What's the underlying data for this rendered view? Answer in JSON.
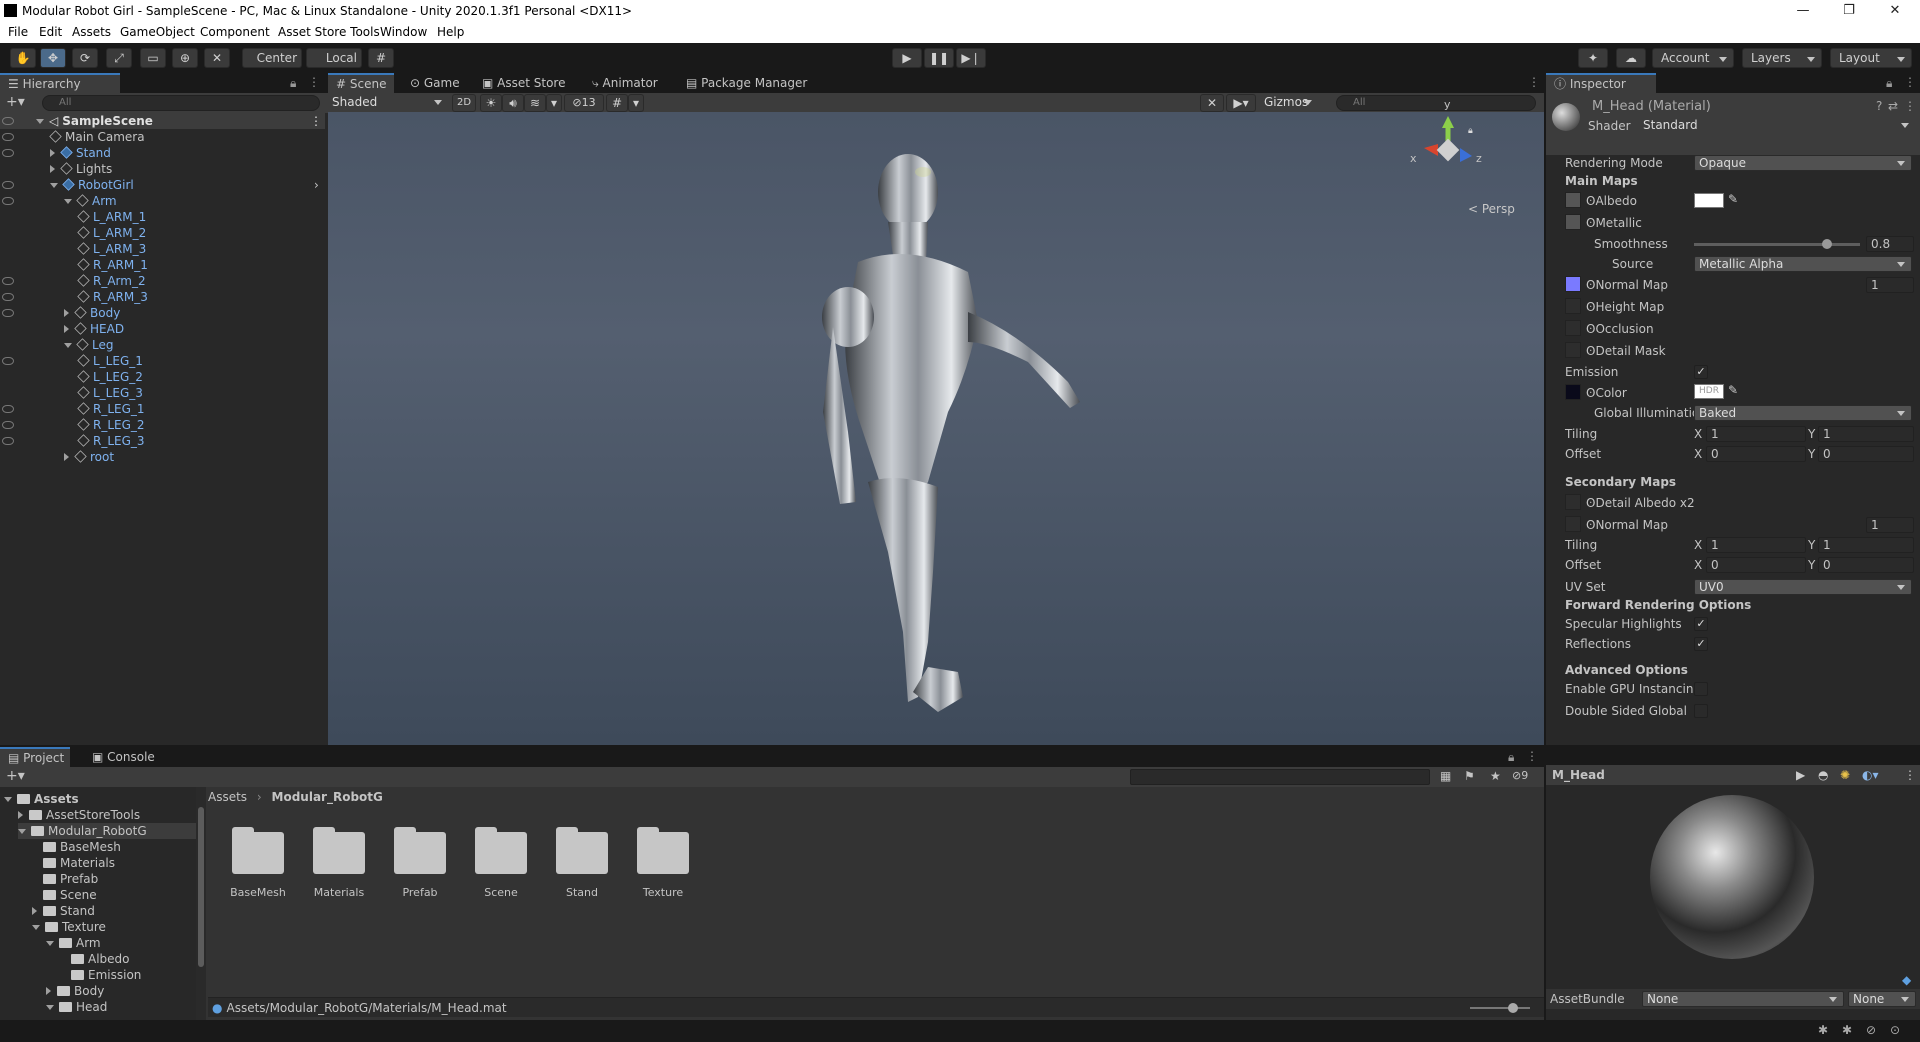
{
  "window": {
    "title": "Modular Robot Girl - SampleScene - PC, Mac & Linux Standalone - Unity 2020.1.3f1 Personal <DX11>",
    "minimize": "—",
    "maximize": "❐",
    "close": "✕"
  },
  "menu": [
    "File",
    "Edit",
    "Assets",
    "GameObject",
    "Component",
    "Asset Store Tools",
    "Window",
    "Help"
  ],
  "toolbar": {
    "pivot": "Center",
    "space": "Local",
    "account": "Account",
    "layers": "Layers",
    "layout": "Layout"
  },
  "hierarchy": {
    "tab": "Hierarchy",
    "search_placeholder": "All",
    "scene": "SampleScene",
    "items": [
      {
        "label": "Main Camera",
        "depth": 1,
        "arrow": "",
        "blue": false
      },
      {
        "label": "Stand",
        "depth": 1,
        "arrow": "r",
        "blue": true
      },
      {
        "label": "Lights",
        "depth": 1,
        "arrow": "r",
        "blue": false
      },
      {
        "label": "RobotGirl",
        "depth": 1,
        "arrow": "d",
        "blue": true
      },
      {
        "label": "Arm",
        "depth": 2,
        "arrow": "d",
        "blue": true
      },
      {
        "label": "L_ARM_1",
        "depth": 3,
        "arrow": "",
        "blue": true
      },
      {
        "label": "L_ARM_2",
        "depth": 3,
        "arrow": "",
        "blue": true
      },
      {
        "label": "L_ARM_3",
        "depth": 3,
        "arrow": "",
        "blue": true
      },
      {
        "label": "R_ARM_1",
        "depth": 3,
        "arrow": "",
        "blue": true
      },
      {
        "label": "R_Arm_2",
        "depth": 3,
        "arrow": "",
        "blue": true
      },
      {
        "label": "R_ARM_3",
        "depth": 3,
        "arrow": "",
        "blue": true
      },
      {
        "label": "Body",
        "depth": 2,
        "arrow": "r",
        "blue": true
      },
      {
        "label": "HEAD",
        "depth": 2,
        "arrow": "r",
        "blue": true
      },
      {
        "label": "Leg",
        "depth": 2,
        "arrow": "d",
        "blue": true
      },
      {
        "label": "L_LEG_1",
        "depth": 3,
        "arrow": "",
        "blue": true
      },
      {
        "label": "L_LEG_2",
        "depth": 3,
        "arrow": "",
        "blue": true
      },
      {
        "label": "L_LEG_3",
        "depth": 3,
        "arrow": "",
        "blue": true
      },
      {
        "label": "R_LEG_1",
        "depth": 3,
        "arrow": "",
        "blue": true
      },
      {
        "label": "R_LEG_2",
        "depth": 3,
        "arrow": "",
        "blue": true
      },
      {
        "label": "R_LEG_3",
        "depth": 3,
        "arrow": "",
        "blue": true
      },
      {
        "label": "root",
        "depth": 2,
        "arrow": "r",
        "blue": true
      }
    ]
  },
  "scene_tabs": [
    "Scene",
    "Game",
    "Asset Store",
    "Animator",
    "Package Manager"
  ],
  "scene_toolbar": {
    "shading": "Shaded",
    "mode2d": "2D",
    "hidden_count": "13",
    "gizmos": "Gizmos",
    "search_placeholder": "All"
  },
  "gizmo": {
    "y": "y",
    "x": "x",
    "z": "z",
    "persp": "< Persp"
  },
  "inspector": {
    "tab": "Inspector",
    "material": "M_Head (Material)",
    "shader_label": "Shader",
    "shader": "Standard",
    "rendering_mode_label": "Rendering Mode",
    "rendering_mode": "Opaque",
    "main_maps": "Main Maps",
    "albedo": "Albedo",
    "metallic": "Metallic",
    "smoothness_label": "Smoothness",
    "smoothness": "0.8",
    "smoothness_fraction": 0.8,
    "source_label": "Source",
    "source": "Metallic Alpha",
    "normal_map": "Normal Map",
    "normal_value": "1",
    "height_map": "Height Map",
    "occlusion": "Occlusion",
    "detail_mask": "Detail Mask",
    "emission": "Emission",
    "emission_checked": "✓",
    "color": "Color",
    "hdr": "HDR",
    "gi_label": "Global Illuminatio",
    "gi": "Baked",
    "tiling": "Tiling",
    "offset": "Offset",
    "x": "X",
    "y": "Y",
    "tiling_x": "1",
    "tiling_y": "1",
    "offset_x": "0",
    "offset_y": "0",
    "secondary_maps": "Secondary Maps",
    "detail_albedo": "Detail Albedo x2",
    "normal_map2": "Normal Map",
    "normal_value2": "1",
    "tiling2_x": "1",
    "tiling2_y": "1",
    "offset2_x": "0",
    "offset2_y": "0",
    "uv_set_label": "UV Set",
    "uv_set": "UV0",
    "forward": "Forward Rendering Options",
    "specular": "Specular Highlights",
    "reflections": "Reflections",
    "check": "✓",
    "advanced": "Advanced Options",
    "gpu_instancing": "Enable GPU Instancing",
    "double_sided": "Double Sided Global Illu",
    "preview_name": "M_Head",
    "assetbundle_label": "AssetBundle",
    "assetbundle": "None",
    "variant": "None"
  },
  "project": {
    "tabs": [
      "Project",
      "Console"
    ],
    "tree": [
      {
        "label": "Assets",
        "depth": 0,
        "arrow": "d",
        "bold": true
      },
      {
        "label": "AssetStoreTools",
        "depth": 1,
        "arrow": "r",
        "bold": false
      },
      {
        "label": "Modular_RobotG",
        "depth": 1,
        "arrow": "d",
        "bold": false
      },
      {
        "label": "BaseMesh",
        "depth": 2,
        "arrow": "",
        "bold": false
      },
      {
        "label": "Materials",
        "depth": 2,
        "arrow": "",
        "bold": false
      },
      {
        "label": "Prefab",
        "depth": 2,
        "arrow": "",
        "bold": false
      },
      {
        "label": "Scene",
        "depth": 2,
        "arrow": "",
        "bold": false
      },
      {
        "label": "Stand",
        "depth": 2,
        "arrow": "r",
        "bold": false
      },
      {
        "label": "Texture",
        "depth": 2,
        "arrow": "d",
        "bold": false
      },
      {
        "label": "Arm",
        "depth": 3,
        "arrow": "d",
        "bold": false
      },
      {
        "label": "Albedo",
        "depth": 4,
        "arrow": "",
        "bold": false
      },
      {
        "label": "Emission",
        "depth": 4,
        "arrow": "",
        "bold": false
      },
      {
        "label": "Body",
        "depth": 3,
        "arrow": "r",
        "bold": false
      },
      {
        "label": "Head",
        "depth": 3,
        "arrow": "d",
        "bold": false
      }
    ],
    "breadcrumb": [
      "Assets",
      "Modular_RobotG"
    ],
    "hidden_count": "9",
    "folders": [
      "BaseMesh",
      "Materials",
      "Prefab",
      "Scene",
      "Stand",
      "Texture"
    ],
    "status_path": "Assets/Modular_RobotG/Materials/M_Head.mat"
  }
}
